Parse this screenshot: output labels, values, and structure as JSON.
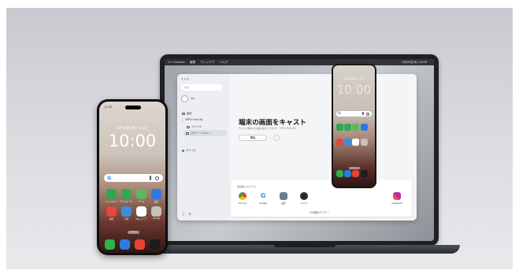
{
  "menubar": {
    "items": [
      "O+ Connect",
      "編集",
      "ウィンドウ",
      "ヘルプ"
    ],
    "right": "3月28日(木) 10:00"
  },
  "sidebar": {
    "search_placeholder": "検索",
    "user": "me",
    "items": [
      {
        "label": "最近"
      },
      {
        "label": "OPPO Find X8"
      },
      {
        "label": "ファイル"
      },
      {
        "label": "スクリーンキャ..."
      },
      {
        "label": "デバイス"
      }
    ]
  },
  "main": {
    "title": "端末の画面をキャスト",
    "subtitle": "PC から端末の画面を操作できます · OPPO Find X8",
    "start_label": "開始",
    "info_label": "i",
    "recent_title": "最近使ったアプリ",
    "others_label": "その他のアプリ ›",
    "apps": [
      {
        "label": "Chrome",
        "color": "#e8e8e8"
      },
      {
        "label": "Google",
        "color": "#ffffff"
      },
      {
        "label": "設定",
        "color": "#6b7c93"
      },
      {
        "label": "カメラ",
        "color": "#2a2a2a"
      },
      {
        "label": "Instagram",
        "color": "#d6297b"
      }
    ]
  },
  "phone": {
    "status_time": "11:33",
    "date": "1月10日(月) ☀ 12°",
    "clock": "10:00",
    "search_logo": "G",
    "pill_label": "アプリ",
    "apps": [
      {
        "label": "フォンマネージャー",
        "color": "#2fa84f"
      },
      {
        "label": "アプリマーケット",
        "color": "#34a853"
      },
      {
        "label": "ゲーム",
        "color": "#5cb85c"
      },
      {
        "label": "設定",
        "color": "#2b78e4"
      },
      {
        "label": "動画",
        "color": "#e8453c"
      },
      {
        "label": "写真",
        "color": "#3c8dde"
      },
      {
        "label": "Play ストア",
        "color": "#ffffff"
      },
      {
        "label": "Google",
        "color": "#c7c0bb"
      }
    ],
    "dock": [
      {
        "color": "#2db34a"
      },
      {
        "color": "#2b7de1"
      },
      {
        "color": "#e94235"
      },
      {
        "color": "#1d1d1d"
      }
    ]
  },
  "mirror": {
    "date": "1月10日(月) ☀ 12°",
    "clock": "10:00",
    "search_logo": "G",
    "apps": [
      {
        "color": "#2fa84f"
      },
      {
        "color": "#34a853"
      },
      {
        "color": "#5cb85c"
      },
      {
        "color": "#2b78e4"
      },
      {
        "color": "#e8453c"
      },
      {
        "color": "#3c8dde"
      },
      {
        "color": "#ffffff"
      },
      {
        "color": "#c7c0bb"
      }
    ],
    "dock": [
      {
        "color": "#2db34a"
      },
      {
        "color": "#2b7de1"
      },
      {
        "color": "#e94235"
      },
      {
        "color": "#1d1d1d"
      }
    ]
  }
}
